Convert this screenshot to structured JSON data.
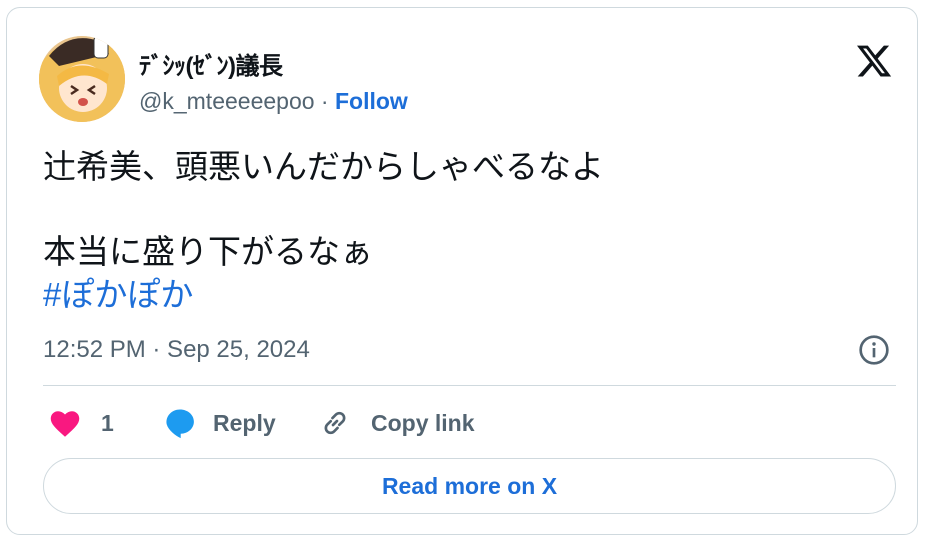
{
  "author": {
    "display_name": "ﾃﾞｼｯ(ｾﾞﾝ)議長",
    "handle": "@k_mteeeeepoo",
    "separator": " · ",
    "follow_label": "Follow"
  },
  "tweet": {
    "line1": "辻希美、頭悪いんだからしゃべるなよ",
    "line2": "本当に盛り下がるなぁ",
    "hashtag": "#ぽかぽか",
    "timestamp": "12:52 PM · Sep 25, 2024"
  },
  "actions": {
    "like_count": "1",
    "reply_label": "Reply",
    "copy_label": "Copy link"
  },
  "read_more_label": "Read more on X",
  "icons": {
    "brand": "x-logo-icon",
    "like": "heart-icon",
    "reply": "speech-bubble-icon",
    "copy": "link-icon",
    "info": "info-icon"
  },
  "colors": {
    "link_blue": "#1d6ed8",
    "heart_pink": "#f91880",
    "reply_blue": "#1d9bf0",
    "muted_text": "#536471",
    "border": "#cfd9de"
  }
}
